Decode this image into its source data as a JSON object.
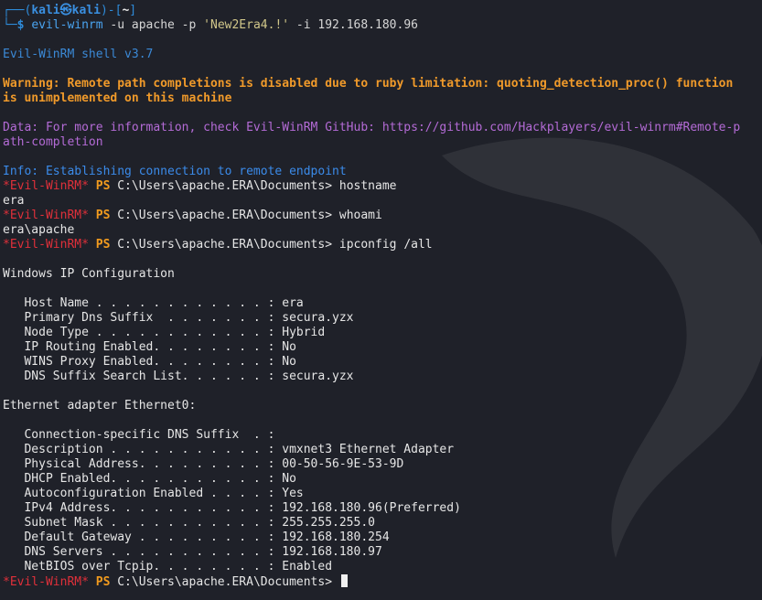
{
  "prompt": {
    "frame_top_left": "┌──(",
    "user": "kali",
    "at": "㉿",
    "host": "kali",
    "frame_mid": ")-[",
    "dir": "~",
    "frame_end": "]",
    "frame_bottom": "└─",
    "dollar": "$ ",
    "command": "evil-winrm",
    "args": " -u apache -p ",
    "password": "'New2Era4.!'",
    "args2": " -i 192.168.180.96"
  },
  "banner": {
    "shell_version": "Evil-WinRM shell v3.7",
    "warning_1": "Warning: Remote path completions is disabled due to ruby limitation: quoting_detection_proc() function",
    "warning_2": "is unimplemented on this machine",
    "data_1": "Data: For more information, check Evil-WinRM GitHub: https://github.com/Hackplayers/evil-winrm#Remote-p",
    "data_2": "ath-completion",
    "info": "Info: Establishing connection to remote endpoint"
  },
  "ps_prompt": {
    "evil": "*Evil-WinRM*",
    "ps": " PS ",
    "path": "C:\\Users\\apache.ERA\\Documents> "
  },
  "session": [
    {
      "command": "hostname",
      "output": [
        "era"
      ]
    },
    {
      "command": "whoami",
      "output": [
        "era\\apache"
      ]
    },
    {
      "command": "ipconfig /all",
      "output": []
    }
  ],
  "ipconfig": {
    "heading": "Windows IP Configuration",
    "global": [
      "   Host Name . . . . . . . . . . . . : era",
      "   Primary Dns Suffix  . . . . . . . : secura.yzx",
      "   Node Type . . . . . . . . . . . . : Hybrid",
      "   IP Routing Enabled. . . . . . . . : No",
      "   WINS Proxy Enabled. . . . . . . . : No",
      "   DNS Suffix Search List. . . . . . : secura.yzx"
    ],
    "adapter_heading": "Ethernet adapter Ethernet0:",
    "adapter": [
      "   Connection-specific DNS Suffix  . :",
      "   Description . . . . . . . . . . . : vmxnet3 Ethernet Adapter",
      "   Physical Address. . . . . . . . . : 00-50-56-9E-53-9D",
      "   DHCP Enabled. . . . . . . . . . . : No",
      "   Autoconfiguration Enabled . . . . : Yes",
      "   IPv4 Address. . . . . . . . . . . : 192.168.180.96(Preferred)",
      "   Subnet Mask . . . . . . . . . . . : 255.255.255.0",
      "   Default Gateway . . . . . . . . . : 192.168.180.254",
      "   DNS Servers . . . . . . . . . . . : 192.168.180.97",
      "   NetBIOS over Tcpip. . . . . . . . : Enabled"
    ]
  },
  "colors": {
    "background": "#1f2129",
    "evil_prompt": "#e0303a",
    "ps_label": "#f29b1e",
    "warning": "#f09a2a",
    "data": "#b46bd6",
    "info": "#3b8bea"
  }
}
